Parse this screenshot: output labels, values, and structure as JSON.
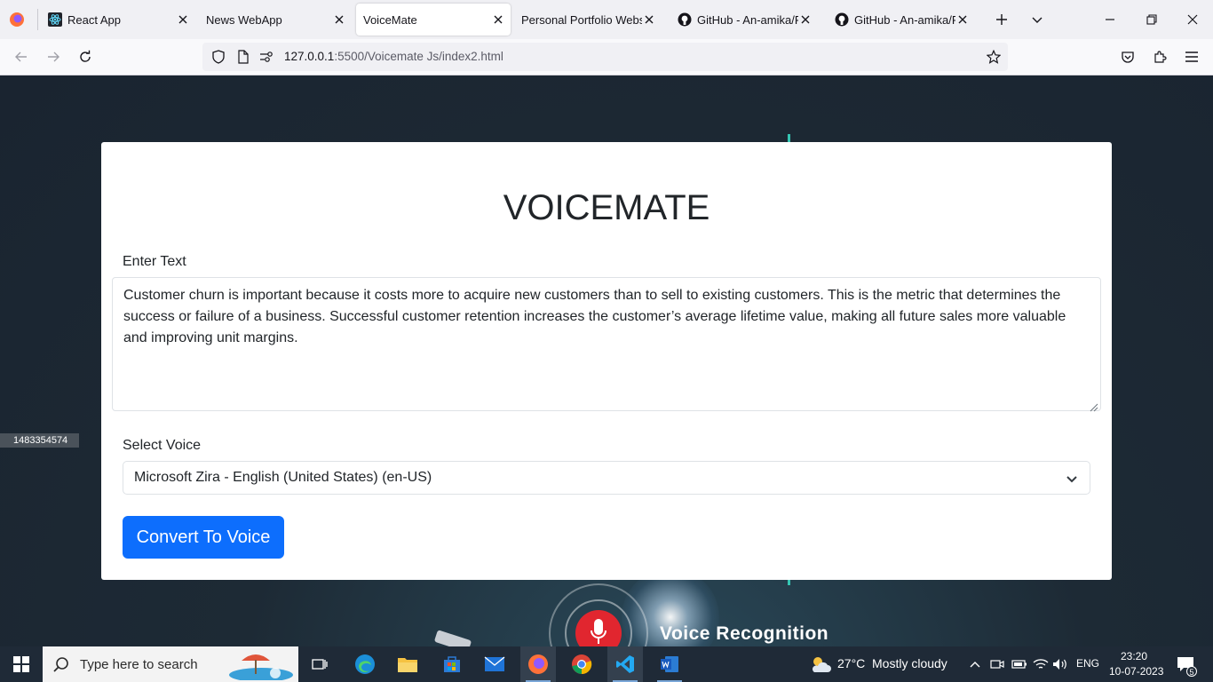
{
  "browser": {
    "tabs": [
      {
        "title": "React App",
        "favicon": "react-icon",
        "active": false
      },
      {
        "title": "News WebApp",
        "favicon": "",
        "active": false
      },
      {
        "title": "VoiceMate",
        "favicon": "",
        "active": true
      },
      {
        "title": "Personal Portfolio Website",
        "favicon": "",
        "active": false
      },
      {
        "title": "GitHub - An-amika/Fa",
        "favicon": "github-icon",
        "active": false
      },
      {
        "title": "GitHub - An-amika/Fa",
        "favicon": "github-icon",
        "active": false
      }
    ],
    "url_host": "127.0.0.1",
    "url_path": ":5500/Voicemate Js/index2.html"
  },
  "page": {
    "id_label": "1483354574",
    "overlay_text": "Voice Recognition"
  },
  "app": {
    "title": "VOICEMATE",
    "text_label": "Enter Text",
    "text_value": "Customer churn is important because it costs more to acquire new customers than to sell to existing customers. This is the metric that determines the success or failure of a business. Successful customer retention increases the customer’s average lifetime value, making all future sales more valuable and improving unit margins.",
    "voice_label": "Select Voice",
    "voice_selected": "Microsoft Zira - English (United States) (en-US)",
    "convert_button": "Convert To Voice",
    "accent_color": "#0d6efd"
  },
  "taskbar": {
    "search_placeholder": "Type here to search",
    "weather_temp": "27°C",
    "weather_desc": "Mostly cloudy",
    "language": "ENG",
    "time": "23:20",
    "date": "10-07-2023",
    "notifications": "5"
  }
}
